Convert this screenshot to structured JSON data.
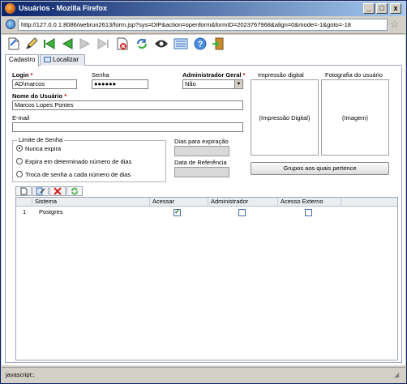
{
  "window": {
    "title": "Usuários - Mozilla Firefox",
    "minimize": "_",
    "maximize": "□",
    "close": "x"
  },
  "address": {
    "url": "http://127.0.0.1:8086/webrun2613/form.jsp?sys=DIP&action=openform&formID=2023767968&align=0&mode=-1&goto=-18"
  },
  "toolbar": {
    "icons": [
      "new-document-icon",
      "edit-pencil-icon",
      "first-record-icon",
      "previous-record-icon",
      "next-record-icon",
      "last-record-icon",
      "delete-icon",
      "refresh-icon",
      "search-eye-icon",
      "list-icon",
      "help-icon",
      "exit-door-icon"
    ]
  },
  "tabs": [
    {
      "label": "Cadastro"
    },
    {
      "label": "Localizar"
    }
  ],
  "form": {
    "login_label": "Login",
    "login_value": "AD\\marcos",
    "senha_label": "Senha",
    "senha_value": "●●●●●●",
    "admin_label": "Administrador Geral",
    "admin_value": "Não",
    "nome_label": "Nome do Usuário",
    "nome_value": "Marcos Lopes Pontes",
    "email_label": "E-mail",
    "email_value": "",
    "limite_legend": "Limite de Senha",
    "radio_options": [
      "Nunca expira",
      "Expira em determinado número de dias",
      "Troca de senha a cada número de dias"
    ],
    "dias_label": "Dias para expiração",
    "data_ref_label": "Data de Referência",
    "digital_label": "Impressão digital",
    "digital_placeholder": "(Impressão Digital)",
    "foto_label": "Fotografia do usuário",
    "foto_placeholder": "(Imagem)",
    "grupos_button": "Grupos aos quais pertence",
    "required_mark": "*"
  },
  "grid": {
    "columns": [
      "Sistema",
      "Acessar",
      "Administrador",
      "Acesso Externo"
    ],
    "rows": [
      {
        "num": "1",
        "sistema": "Postgres",
        "acessar": true,
        "administrador": false,
        "acesso_externo": false
      }
    ]
  },
  "status": {
    "text": "javascript:;"
  },
  "colors": {
    "titlebar": "#0a246a",
    "required": "#d00000",
    "border": "#9aa6b8"
  }
}
